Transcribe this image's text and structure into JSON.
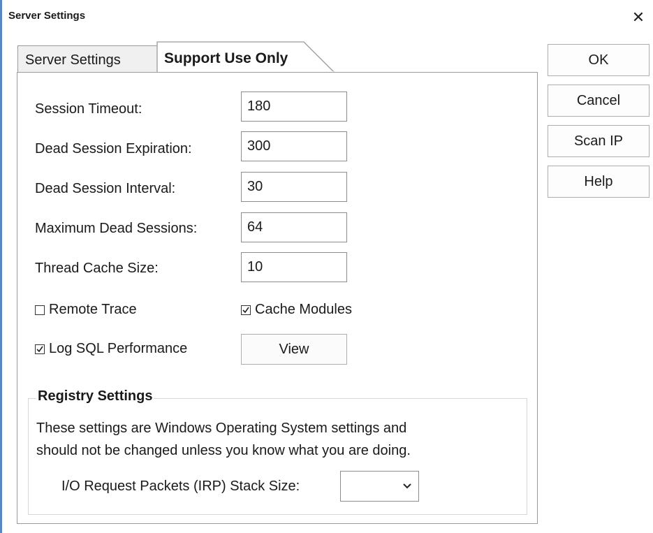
{
  "window": {
    "title": "Server Settings",
    "close_symbol": "✕"
  },
  "tabs": [
    {
      "label": "Server Settings",
      "active": false
    },
    {
      "label": "Support Use Only",
      "active": true
    }
  ],
  "fields": [
    {
      "label": "Session Timeout:",
      "value": "180"
    },
    {
      "label": "Dead Session Expiration:",
      "value": "300"
    },
    {
      "label": "Dead Session Interval:",
      "value": "30"
    },
    {
      "label": "Maximum Dead Sessions:",
      "value": "64"
    },
    {
      "label": "Thread Cache Size:",
      "value": "10"
    }
  ],
  "checkboxes": {
    "remote_trace": {
      "label": "Remote Trace",
      "checked": false
    },
    "cache_modules": {
      "label": "Cache Modules",
      "checked": true
    },
    "log_sql": {
      "label": "Log SQL Performance",
      "checked": true
    }
  },
  "view_button": "View",
  "registry": {
    "title": "Registry Settings",
    "line1": "These settings are Windows Operating System settings and",
    "line2": "should not be changed unless you know what you are doing.",
    "irp_label": "I/O Request Packets (IRP) Stack Size:",
    "irp_value": ""
  },
  "buttons": {
    "ok": "OK",
    "cancel": "Cancel",
    "scan_ip": "Scan IP",
    "help": "Help"
  },
  "icons": {
    "close": "close-icon",
    "checkmark": "checkmark-icon",
    "dropdown": "chevron-down-icon"
  },
  "colors": {
    "window_edge": "#5a86c2",
    "border": "#9a9a9a",
    "tab_inactive_bg": "#f0f0f0"
  }
}
